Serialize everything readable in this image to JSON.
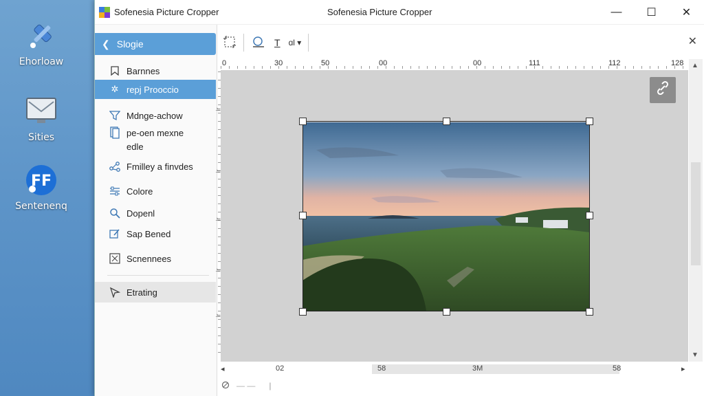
{
  "desktop": {
    "icons": [
      {
        "label": "Ehorloaw",
        "icon": "tools-icon"
      },
      {
        "label": "Sities",
        "icon": "monitor-icon"
      },
      {
        "label": "Sentenenq",
        "icon": "app-logo-icon"
      }
    ]
  },
  "window": {
    "app_name": "Sofenesia Picture Cropper",
    "title": "Sofenesia Picture Cropper",
    "controls": {
      "minimize": "—",
      "maximize": "☐",
      "close": "✕"
    }
  },
  "sidebar": {
    "back_label": "Slogie",
    "items": [
      {
        "label": "Barnnes",
        "icon": "bookmark-icon"
      },
      {
        "label": "repj Prooccio",
        "icon": "settings-star-icon",
        "selected": true
      },
      {
        "label": "Mdnge-achow",
        "icon": "filter-icon"
      },
      {
        "label": "pe-oen mexne",
        "label2": "edle",
        "icon": "document-icon"
      },
      {
        "label": "Fmilley a finvdes",
        "icon": "share-icon"
      },
      {
        "label": "Colore",
        "icon": "sliders-icon"
      },
      {
        "label": "Dopenl",
        "icon": "magnifier-icon"
      },
      {
        "label": "Sap Bened",
        "icon": "edit-icon"
      },
      {
        "label": "Scnennees",
        "icon": "crop-frame-icon"
      }
    ],
    "footer_label": "Etrating"
  },
  "toolbar": {
    "buttons": [
      "crop-tool-icon",
      "shape-tool-icon",
      "text-tool-icon",
      "rotate-tool-icon"
    ],
    "text_tool": "T",
    "rotate_tool": "ɑl ▾",
    "close": "✕"
  },
  "ruler_top": [
    "0",
    "30",
    "50",
    "00",
    "00",
    "111",
    "112",
    "128"
  ],
  "ruler_left": [
    "ir",
    "ir",
    "ir",
    "ir",
    "ir"
  ],
  "ruler_bottom": [
    "◂",
    "02",
    "58",
    "3M",
    "58",
    "▸"
  ],
  "status": {
    "icon": "settings-icon",
    "dashes": "—   —",
    "sep": "|"
  },
  "colors": {
    "accent": "#5b9fd8",
    "canvas": "#d2d2d2"
  }
}
